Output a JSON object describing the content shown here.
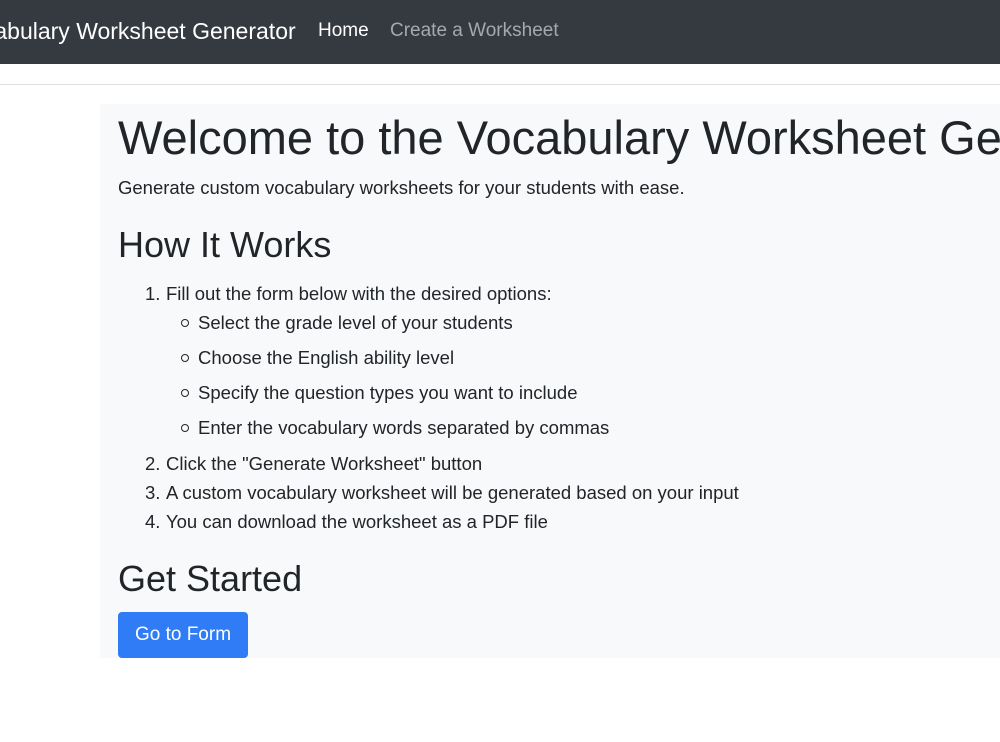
{
  "navbar": {
    "brand": "Vocabulary Worksheet Generator",
    "links": [
      {
        "label": "Home",
        "active": true
      },
      {
        "label": "Create a Worksheet",
        "active": false
      }
    ]
  },
  "main": {
    "title": "Welcome to the Vocabulary Worksheet Generator",
    "lead": "Generate custom vocabulary worksheets for your students with ease.",
    "how_heading": "How It Works",
    "steps": [
      {
        "num": "1.",
        "text": "Fill out the form below with the desired options:"
      },
      {
        "num": "2.",
        "text": "Click the \"Generate Worksheet\" button"
      },
      {
        "num": "3.",
        "text": "A custom vocabulary worksheet will be generated based on your input"
      },
      {
        "num": "4.",
        "text": "You can download the worksheet as a PDF file"
      }
    ],
    "substeps": [
      "Select the grade level of your students",
      "Choose the English ability level",
      "Specify the question types you want to include",
      "Enter the vocabulary words separated by commas"
    ],
    "start_heading": "Get Started",
    "button_label": "Go to Form"
  },
  "colors": {
    "navbar_bg": "#343a40",
    "jumbotron_bg": "#f8f9fa",
    "primary": "#2f7cf6",
    "inactive_link": "#a5a9ad"
  }
}
